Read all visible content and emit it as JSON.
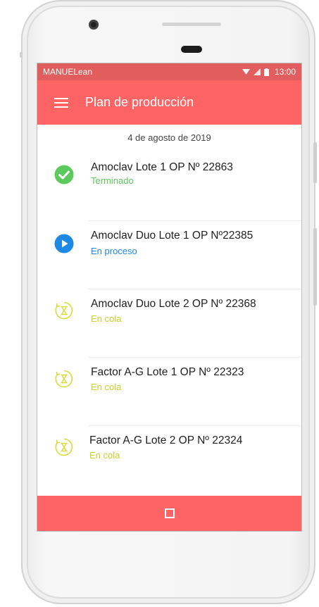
{
  "statusbar": {
    "app_name": "MANUELean",
    "time": "13:00"
  },
  "appbar": {
    "title": "Plan de producción",
    "menu_icon": "menu-icon"
  },
  "date": "4 de agosto de 2019",
  "colors": {
    "primary": "#ff6464",
    "statusbar": "#e25e5e",
    "done": "#5bc95b",
    "in_process": "#1e88e5",
    "queued": "#d4dd3c"
  },
  "items": [
    {
      "name": "Amoclav Lote 1 OP Nº 22863",
      "status": "Terminado",
      "icon": "check-circle-icon"
    },
    {
      "name": "Amoclav Duo Lote 1 OP Nº22385",
      "status": "En proceso",
      "icon": "play-circle-icon"
    },
    {
      "name": "Amoclav Duo Lote 2 OP Nº 22368",
      "status": "En cola",
      "icon": "hourglass-icon"
    },
    {
      "name": "Factor A-G Lote 1 OP Nº 22323",
      "status": "En cola",
      "icon": "hourglass-icon"
    },
    {
      "name": "Factor A-G Lote 2 OP Nº 22324",
      "status": "En cola",
      "icon": "hourglass-icon"
    }
  ]
}
